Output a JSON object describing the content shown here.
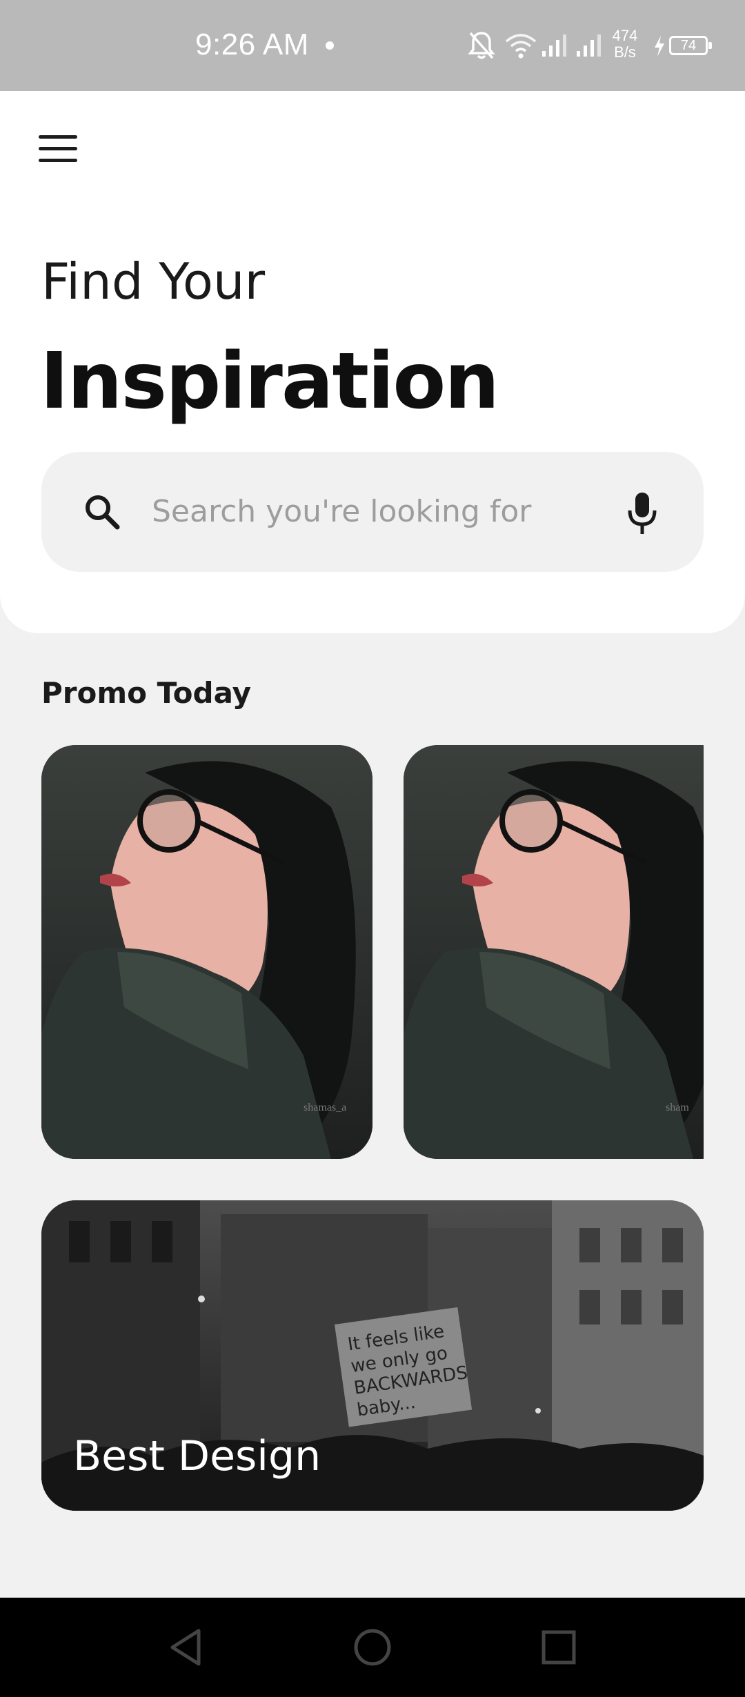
{
  "status_bar": {
    "time": "9:26 AM",
    "net_speed_value": "474",
    "net_speed_unit": "B/s",
    "battery": "74",
    "icons": [
      "notifications-off-icon",
      "wifi-icon",
      "signal-icon",
      "signal-icon",
      "charging-icon",
      "battery-icon"
    ]
  },
  "header": {
    "menu_icon": "hamburger-menu-icon",
    "title_line1": "Find Your",
    "title_line2": "Inspiration"
  },
  "search": {
    "placeholder": "Search you're looking for",
    "value": "",
    "left_icon": "search-icon",
    "right_icon": "microphone-icon"
  },
  "promo": {
    "section_title": "Promo Today",
    "cards": [
      {
        "image": "illustration of woman with glasses",
        "watermark": "shamas_a"
      },
      {
        "image": "illustration of woman with glasses",
        "watermark": "sham"
      }
    ],
    "banner": {
      "label": "Best Design",
      "sign_text": "It feels like we only go BACKWARDS baby..."
    }
  },
  "nav": {
    "back_icon": "back-triangle-icon",
    "home_icon": "home-circle-icon",
    "recents_icon": "recents-square-icon"
  },
  "colors": {
    "status_bar_bg": "#b9b9b9",
    "page_bg": "#f1f1f1",
    "card_bg": "#ffffff",
    "text_dark": "#1a1a1a",
    "placeholder": "#9d9d9d",
    "nav_bg": "#000000"
  }
}
